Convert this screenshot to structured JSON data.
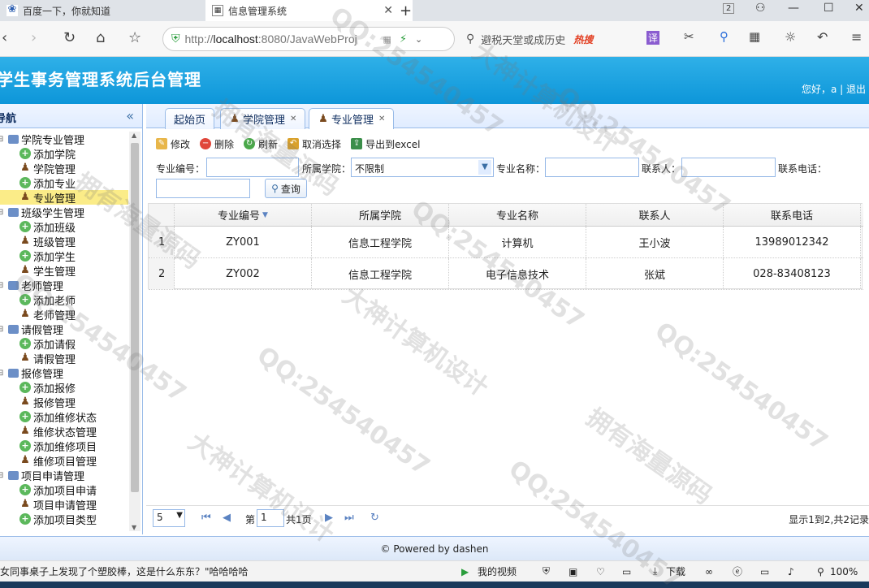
{
  "browser": {
    "tabs": [
      {
        "title": "百度一下，你就知道",
        "icon": "paw-icon"
      },
      {
        "title": "信息管理系统",
        "icon": "page-icon"
      }
    ],
    "tab_counter": "2",
    "address_url_prefix": "http://",
    "address_url_host": "localhost",
    "address_url_rest": ":8080/JavaWebProj",
    "search_placeholder": "避税天堂或成历史",
    "search_hot": "热搜"
  },
  "app": {
    "title": "学生事务管理系统后台管理",
    "greeting": "您好，a | 退出"
  },
  "nav": {
    "title": "导航",
    "collapse": "«",
    "groups": [
      {
        "label": "学院专业管理",
        "items": [
          "添加学院",
          "学院管理",
          "添加专业",
          "专业管理"
        ]
      },
      {
        "label": "班级学生管理",
        "items": [
          "添加班级",
          "班级管理",
          "添加学生",
          "学生管理"
        ]
      },
      {
        "label": "老师管理",
        "items": [
          "添加老师",
          "老师管理"
        ]
      },
      {
        "label": "请假管理",
        "items": [
          "添加请假",
          "请假管理"
        ]
      },
      {
        "label": "报修管理",
        "items": [
          "添加报修",
          "报修管理",
          "添加维修状态",
          "维修状态管理",
          "添加维修项目",
          "维修项目管理"
        ]
      },
      {
        "label": "项目申请管理",
        "items": [
          "添加项目申请",
          "项目申请管理",
          "添加项目类型"
        ]
      }
    ]
  },
  "tabs": {
    "home": "起始页",
    "college": "学院管理",
    "major": "专业管理"
  },
  "toolbar": {
    "edit": "修改",
    "delete": "删除",
    "refresh": "刷新",
    "cancel_select": "取消选择",
    "export": "导出到excel"
  },
  "filter": {
    "major_no_label": "专业编号：",
    "college_label": "所属学院：",
    "college_value": "不限制",
    "major_name_label": "专业名称：",
    "contact_label": "联系人：",
    "phone_label": "联系电话：",
    "query": "查询"
  },
  "grid": {
    "columns": [
      "专业编号",
      "所属学院",
      "专业名称",
      "联系人",
      "联系电话"
    ],
    "rows": [
      {
        "n": "1",
        "no": "ZY001",
        "college": "信息工程学院",
        "name": "计算机",
        "contact": "王小波",
        "phone": "13989012342"
      },
      {
        "n": "2",
        "no": "ZY002",
        "college": "信息工程学院",
        "name": "电子信息技术",
        "contact": "张斌",
        "phone": "028-83408123"
      }
    ]
  },
  "pager": {
    "page_size": "5",
    "page_prefix": "第",
    "page_value": "1",
    "page_total": "共1页",
    "summary": "显示1到2,共2记录"
  },
  "footer": "© Powered by dashen",
  "status": {
    "news": "女同事桌子上发现了个塑胶棒，这是什么东东？\"哈哈哈哈",
    "video": "我的视频",
    "download": "下载",
    "zoom": "100%"
  },
  "watermarks": [
    "QQ:254540457",
    "大神计算机设计",
    "拥有海量源码"
  ]
}
